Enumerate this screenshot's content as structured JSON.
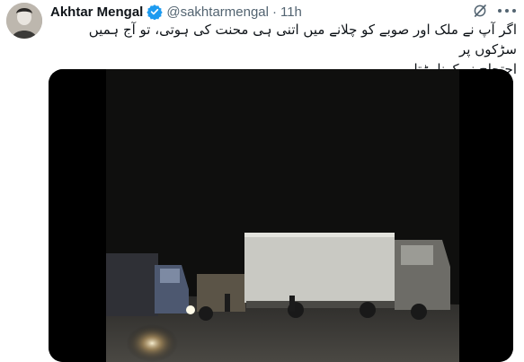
{
  "tweet": {
    "author_name": "Akhtar Mengal",
    "handle": "@sakhtarmengal",
    "separator": "·",
    "timestamp": "11h",
    "text_line_1": "اگر آپ نے ملک اور صوبے کو چلانے میں اتنی ہی محنت کی ہوتی، تو آج ہمیں سڑکوں پر",
    "text_line_2": "احتجاج نہ کرنا پڑتا"
  },
  "icons": {
    "verified": "verified-badge-icon",
    "grok": "grok-icon",
    "more": "more-options-icon"
  },
  "colors": {
    "verified_blue": "#1d9bf0",
    "secondary_text": "#536471",
    "primary_text": "#0f1419"
  },
  "media": {
    "type": "video-still",
    "scene": "night road with trucks"
  }
}
